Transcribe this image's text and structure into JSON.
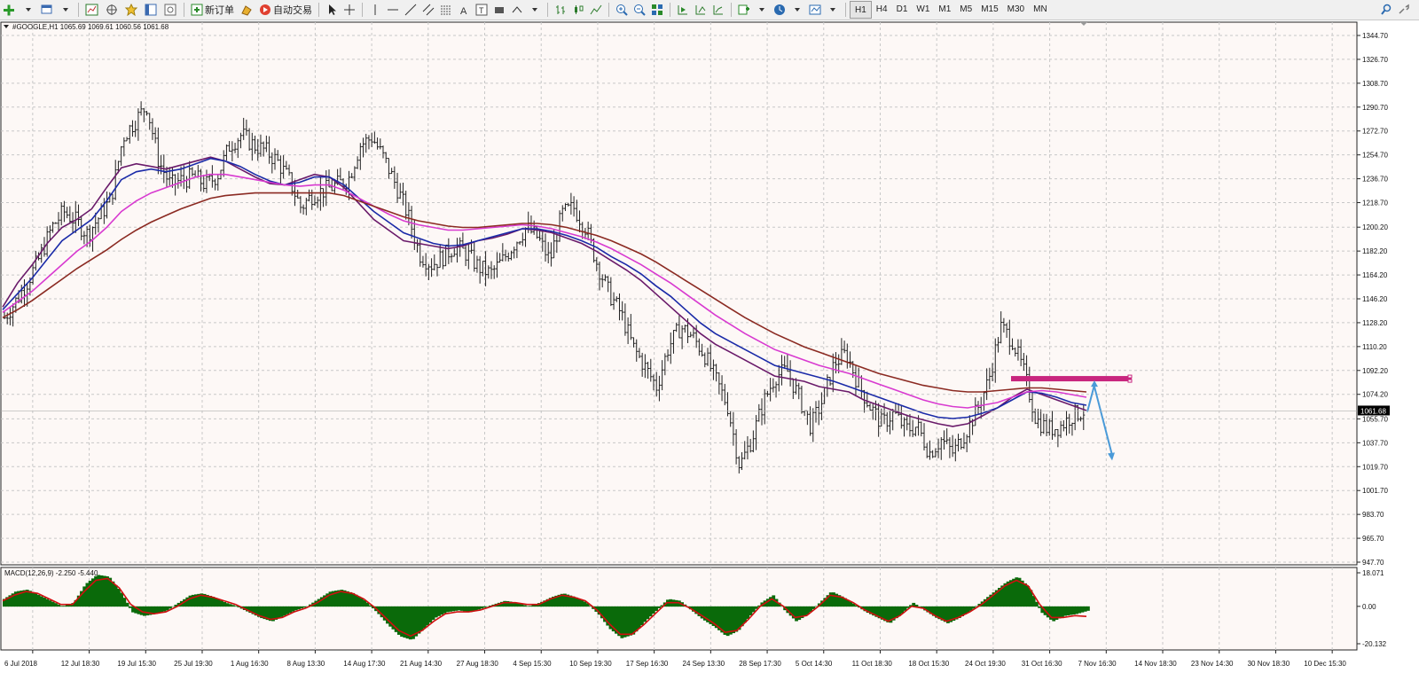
{
  "toolbar": {
    "new_order_label": "新订单",
    "auto_trading_label": "自动交易",
    "timeframes": [
      "H1",
      "H4",
      "D1",
      "W1",
      "M1",
      "M5",
      "M15",
      "M30",
      "MN"
    ],
    "active_timeframe": "H1"
  },
  "chart": {
    "symbol_title": "#GOOGLE,H1",
    "ohlc_text": "1065.69 1069.61 1060.56 1061.68",
    "current_price": "1061.68",
    "indicator_label": "MACD(12,26,9) -2.250 -5.440",
    "colors": {
      "background": "#fdf8f6",
      "bars": "#202020",
      "ma_fast": "#6a1a6a",
      "ma_mid": "#1a2aa8",
      "ma_slow": "#d83ad0",
      "ma_long": "#8b2a22",
      "resistance": "#c8267e",
      "arrow": "#4a9ad8",
      "macd_hist": "#0a6a0a",
      "macd_signal": "#d01010"
    },
    "icons": [
      "new-chart-icon",
      "profiles-icon",
      "market-watch-icon",
      "navigator-icon",
      "data-window-icon",
      "terminal-icon",
      "strategy-tester-icon",
      "new-order-icon",
      "meta-editor-icon",
      "auto-trading-icon",
      "cursor-icon",
      "crosshair-icon",
      "vertical-line-icon",
      "horizontal-line-icon",
      "trendline-icon",
      "equidistant-channel-icon",
      "fibonacci-icon",
      "text-icon",
      "text-label-icon",
      "rectangle-icon",
      "arrows-icon",
      "bar-chart-icon",
      "candlestick-icon",
      "line-chart-icon",
      "zoom-in-icon",
      "zoom-out-icon",
      "tile-windows-icon",
      "auto-scroll-icon",
      "chart-shift-icon",
      "indicators-icon",
      "periods-icon",
      "templates-icon",
      "search-icon",
      "settings-icon"
    ]
  },
  "chart_data": [
    {
      "type": "line",
      "title": "#GOOGLE,H1",
      "y_ticks": [
        "1344.70",
        "1326.70",
        "1308.70",
        "1290.70",
        "1272.70",
        "1254.70",
        "1236.70",
        "1218.70",
        "1200.20",
        "1182.20",
        "1164.20",
        "1146.20",
        "1128.20",
        "1110.20",
        "1092.20",
        "1074.20",
        "1055.70",
        "1037.70",
        "1019.70",
        "1001.70",
        "983.70",
        "965.70",
        "947.70"
      ],
      "ylim": [
        947.7,
        1344.7
      ],
      "x_ticks": [
        "6 Jul 2018",
        "12 Jul 18:30",
        "19 Jul 15:30",
        "25 Jul 19:30",
        "1 Aug 16:30",
        "8 Aug 13:30",
        "14 Aug 17:30",
        "21 Aug 14:30",
        "27 Aug 18:30",
        "4 Sep 15:30",
        "10 Sep 19:30",
        "17 Sep 16:30",
        "24 Sep 13:30",
        "28 Sep 17:30",
        "5 Oct 14:30",
        "11 Oct 18:30",
        "18 Oct 15:30",
        "24 Oct 19:30",
        "31 Oct 16:30",
        "7 Nov 16:30",
        "14 Nov 18:30",
        "23 Nov 14:30",
        "30 Nov 18:30",
        "10 Dec 15:30"
      ],
      "price_path": [
        1132,
        1145,
        1160,
        1178,
        1200,
        1212,
        1205,
        1195,
        1208,
        1222,
        1268,
        1280,
        1292,
        1250,
        1232,
        1236,
        1238,
        1232,
        1240,
        1262,
        1270,
        1262,
        1258,
        1250,
        1236,
        1215,
        1225,
        1228,
        1232,
        1236,
        1262,
        1268,
        1252,
        1232,
        1210,
        1180,
        1172,
        1178,
        1186,
        1180,
        1170,
        1165,
        1175,
        1188,
        1200,
        1192,
        1175,
        1210,
        1215,
        1200,
        1172,
        1150,
        1135,
        1110,
        1095,
        1080,
        1110,
        1125,
        1118,
        1105,
        1085,
        1065,
        1020,
        1040,
        1068,
        1088,
        1092,
        1072,
        1050,
        1070,
        1098,
        1105,
        1082,
        1065,
        1052,
        1060,
        1048,
        1050,
        1030,
        1040,
        1030,
        1045,
        1062,
        1085,
        1125,
        1115,
        1090,
        1055,
        1048,
        1050,
        1058,
        1061.68
      ],
      "series": [
        {
          "name": "MA fast",
          "values": [
            1140,
            1158,
            1172,
            1188,
            1200,
            1206,
            1214,
            1230,
            1245,
            1248,
            1246,
            1244,
            1247,
            1250,
            1253,
            1250,
            1244,
            1238,
            1233,
            1232,
            1236,
            1240,
            1238,
            1230,
            1218,
            1206,
            1198,
            1190,
            1188,
            1186,
            1184,
            1186,
            1190,
            1192,
            1195,
            1199,
            1198,
            1196,
            1192,
            1188,
            1182,
            1175,
            1168,
            1160,
            1150,
            1140,
            1130,
            1120,
            1112,
            1106,
            1100,
            1094,
            1088,
            1086,
            1084,
            1080,
            1078,
            1076,
            1070,
            1066,
            1062,
            1058,
            1055,
            1052,
            1050,
            1052,
            1058,
            1064,
            1072,
            1078,
            1074,
            1070,
            1066,
            1062
          ]
        },
        {
          "name": "MA mid",
          "values": [
            1138,
            1150,
            1162,
            1176,
            1190,
            1198,
            1206,
            1220,
            1236,
            1242,
            1244,
            1242,
            1244,
            1248,
            1252,
            1250,
            1246,
            1240,
            1235,
            1232,
            1234,
            1238,
            1238,
            1232,
            1222,
            1212,
            1204,
            1196,
            1192,
            1188,
            1186,
            1187,
            1190,
            1193,
            1196,
            1199,
            1199,
            1197,
            1194,
            1190,
            1185,
            1178,
            1172,
            1165,
            1156,
            1148,
            1138,
            1128,
            1120,
            1114,
            1108,
            1102,
            1096,
            1093,
            1090,
            1087,
            1084,
            1080,
            1076,
            1072,
            1068,
            1064,
            1060,
            1057,
            1056,
            1057,
            1060,
            1064,
            1070,
            1076,
            1075,
            1072,
            1068,
            1066
          ]
        },
        {
          "name": "MA slow",
          "values": [
            1136,
            1144,
            1152,
            1162,
            1172,
            1182,
            1190,
            1200,
            1212,
            1220,
            1226,
            1230,
            1234,
            1238,
            1240,
            1240,
            1238,
            1236,
            1234,
            1232,
            1231,
            1232,
            1232,
            1228,
            1222,
            1216,
            1210,
            1205,
            1202,
            1200,
            1198,
            1198,
            1199,
            1200,
            1201,
            1202,
            1201,
            1199,
            1196,
            1193,
            1189,
            1184,
            1178,
            1172,
            1165,
            1158,
            1150,
            1142,
            1134,
            1127,
            1120,
            1114,
            1108,
            1104,
            1100,
            1096,
            1093,
            1090,
            1086,
            1082,
            1078,
            1074,
            1070,
            1067,
            1065,
            1064,
            1066,
            1068,
            1072,
            1076,
            1077,
            1076,
            1074,
            1072
          ]
        },
        {
          "name": "MA long",
          "values": [
            1132,
            1138,
            1145,
            1153,
            1161,
            1169,
            1176,
            1183,
            1191,
            1198,
            1204,
            1209,
            1214,
            1218,
            1222,
            1224,
            1225,
            1226,
            1226,
            1226,
            1226,
            1226,
            1226,
            1224,
            1220,
            1216,
            1212,
            1208,
            1205,
            1203,
            1201,
            1200,
            1200,
            1201,
            1202,
            1203,
            1203,
            1202,
            1200,
            1197,
            1194,
            1190,
            1185,
            1180,
            1174,
            1167,
            1160,
            1153,
            1146,
            1139,
            1132,
            1126,
            1120,
            1115,
            1110,
            1106,
            1102,
            1098,
            1094,
            1090,
            1087,
            1084,
            1081,
            1079,
            1077,
            1076,
            1076,
            1077,
            1078,
            1079,
            1079,
            1078,
            1077,
            1076
          ]
        }
      ]
    },
    {
      "type": "bar",
      "title": "MACD(12,26,9) -2.250 -5.440",
      "y_ticks": [
        "18.071",
        "0.00",
        "-20.132"
      ],
      "ylim": [
        -20.132,
        18.071
      ],
      "x_ticks": [
        "6 Jul 2018",
        "12 Jul 18:30",
        "19 Jul 15:30",
        "25 Jul 19:30",
        "1 Aug 16:30",
        "8 Aug 13:30",
        "14 Aug 17:30",
        "21 Aug 14:30",
        "27 Aug 18:30",
        "4 Sep 15:30",
        "10 Sep 19:30",
        "17 Sep 16:30",
        "24 Sep 13:30",
        "28 Sep 17:30",
        "5 Oct 14:30",
        "11 Oct 18:30",
        "18 Oct 15:30",
        "24 Oct 19:30",
        "31 Oct 16:30",
        "7 Nov 16:30",
        "14 Nov 18:30",
        "23 Nov 14:30",
        "30 Nov 18:30",
        "10 Dec 15:30"
      ],
      "histogram": [
        4,
        8,
        9,
        6,
        3,
        0,
        2,
        12,
        17,
        16,
        8,
        -3,
        -5,
        -4,
        -2,
        2,
        6,
        7,
        5,
        2,
        0,
        -3,
        -6,
        -8,
        -5,
        -2,
        0,
        4,
        8,
        9,
        7,
        3,
        -3,
        -10,
        -16,
        -18,
        -12,
        -6,
        -3,
        -2,
        -3,
        -1,
        1,
        3,
        2,
        0,
        2,
        5,
        7,
        5,
        2,
        -4,
        -12,
        -17,
        -15,
        -8,
        -2,
        4,
        3,
        -2,
        -7,
        -11,
        -16,
        -13,
        -5,
        2,
        6,
        -2,
        -8,
        -4,
        2,
        8,
        5,
        1,
        -3,
        -6,
        -9,
        -4,
        2,
        -2,
        -6,
        -9,
        -6,
        -2,
        3,
        8,
        13,
        16,
        10,
        -3,
        -8,
        -5,
        -4,
        -2.25
      ],
      "signal": [
        3,
        6,
        8,
        7,
        4,
        1,
        1,
        8,
        14,
        15,
        10,
        1,
        -3,
        -4,
        -3,
        0,
        4,
        6,
        5,
        3,
        1,
        -2,
        -5,
        -7,
        -6,
        -3,
        -1,
        2,
        6,
        8,
        7,
        4,
        -1,
        -7,
        -13,
        -16,
        -13,
        -8,
        -4,
        -3,
        -3,
        -2,
        0,
        2,
        2,
        1,
        1,
        4,
        6,
        5,
        3,
        -2,
        -9,
        -15,
        -15,
        -10,
        -4,
        2,
        2,
        -1,
        -5,
        -9,
        -14,
        -13,
        -7,
        0,
        4,
        0,
        -6,
        -5,
        0,
        6,
        5,
        2,
        -2,
        -5,
        -8,
        -5,
        0,
        -1,
        -5,
        -8,
        -6,
        -3,
        1,
        6,
        11,
        14,
        11,
        1,
        -6,
        -6,
        -5,
        -5.44
      ]
    }
  ]
}
